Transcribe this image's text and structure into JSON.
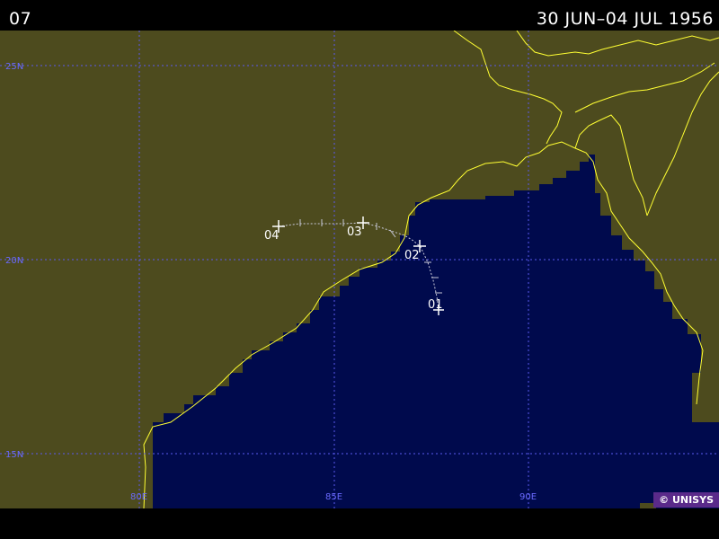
{
  "header": {
    "storm_id": "07",
    "date_range": "30 JUN–04 JUL 1956"
  },
  "colors": {
    "land": "#4d4b1e",
    "ocean": "#000a4d",
    "coast": "#ffff33",
    "grid": "#5a5af0",
    "track": "#c8c8d8",
    "label": "#ffffff"
  },
  "grid": {
    "latitudes": [
      "25N",
      "20N",
      "15N"
    ],
    "longitudes": [
      "80E",
      "85E",
      "90E"
    ]
  },
  "track": {
    "day_labels": [
      "01",
      "02",
      "03",
      "04"
    ]
  },
  "copyright": "© UNISYS"
}
